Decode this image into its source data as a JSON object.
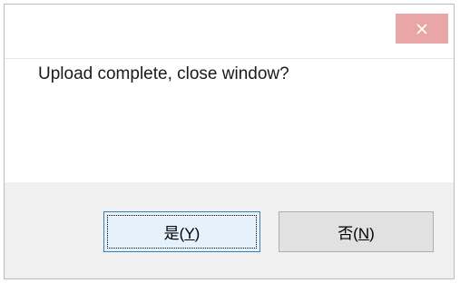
{
  "dialog": {
    "message": "Upload complete, close window?",
    "close_icon": "close-icon"
  },
  "buttons": {
    "yes": {
      "pre": "是(",
      "key": "Y",
      "post": ")"
    },
    "no": {
      "pre": "否(",
      "key": "N",
      "post": ")"
    }
  },
  "colors": {
    "close_button_bg": "#e8a6a6",
    "button_area_bg": "#f0f0f0",
    "default_button_border": "#3c7fb1"
  }
}
